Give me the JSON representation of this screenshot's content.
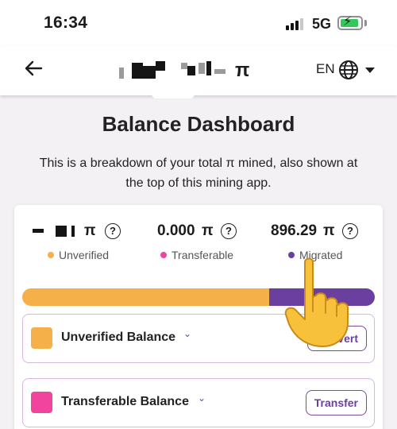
{
  "status": {
    "time": "16:34",
    "network": "5G"
  },
  "header": {
    "currency_symbol": "π",
    "language": "EN"
  },
  "page": {
    "title": "Balance Dashboard",
    "intro": "This is a breakdown of your total π mined, also shown at the top of this mining app."
  },
  "stats": [
    {
      "value": "",
      "unit": "π",
      "label": "Unverified",
      "color": "#f6b04a"
    },
    {
      "value": "0.000",
      "unit": "π",
      "label": "Transferable",
      "color": "#f0449f"
    },
    {
      "value": "896.29",
      "unit": "π",
      "label": "Migrated",
      "color": "#6b3fa0"
    }
  ],
  "help_glyph": "?",
  "progress": {
    "unverified_fraction": 0.7,
    "transferable_fraction": 0.0,
    "migrated_fraction": 0.3
  },
  "balances": [
    {
      "label": "Unverified Balance",
      "button": "Convert",
      "color": "#f6b04a"
    },
    {
      "label": "Transferable Balance",
      "button": "Transfer",
      "color": "#f0449f"
    }
  ],
  "colors": {
    "accent": "#6b3fa0",
    "unverified": "#f6b04a",
    "transferable": "#f0449f",
    "migrated": "#6b3fa0"
  }
}
